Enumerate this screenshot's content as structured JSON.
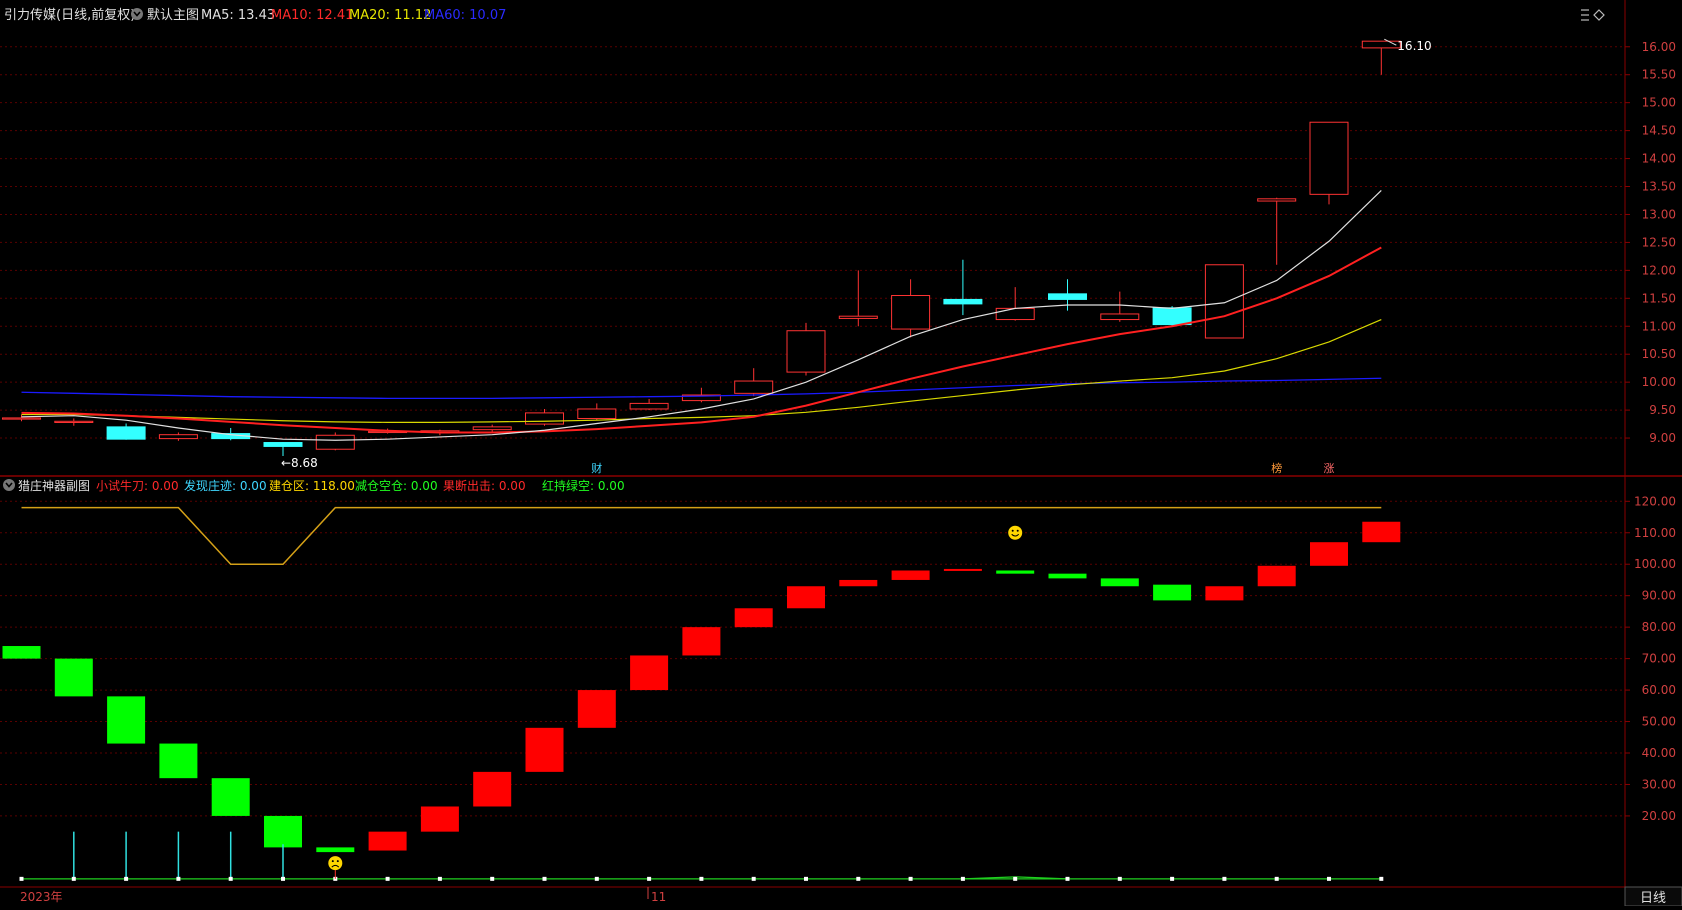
{
  "header": {
    "stock_title": "引力传媒(日线,前复权)",
    "main_chart_name": "默认主图",
    "ma_labels": [
      {
        "label": "MA5: 13.43",
        "color": "#e0e0e0"
      },
      {
        "label": "MA10: 12.41",
        "color": "#ff2a2a"
      },
      {
        "label": "MA20: 11.12",
        "color": "#e6e600"
      },
      {
        "label": "MA60: 10.07",
        "color": "#2a2aff"
      }
    ]
  },
  "sub_header": {
    "indicator_name": "猎庄神器副图",
    "labels": [
      {
        "label": "小试牛刀: 0.00",
        "color": "#ff2a2a"
      },
      {
        "label": "发现庄迹: 0.00",
        "color": "#3fd7ff"
      },
      {
        "label": "建仓区: 118.00",
        "color": "#ffd700"
      },
      {
        "label": "减仓空仓: 0.00",
        "color": "#20ff20"
      },
      {
        "label": "果断出击: 0.00",
        "color": "#ff2a2a"
      },
      {
        "label": "红持绿空: 0.00",
        "color": "#20ff20"
      }
    ]
  },
  "footer": {
    "year_label": "2023年",
    "month_label": "11",
    "period_label": "日线"
  },
  "colors": {
    "up": "#ff3333",
    "down": "#33ffff",
    "ma5": "#e0e0e0",
    "ma10": "#ff2020",
    "ma20": "#d8d800",
    "ma60": "#1a1aff",
    "grid": "#5a0000",
    "axis_text": "#d04040",
    "sub_up": "#ff0000",
    "sub_down": "#00ff00",
    "cang_line": "#d4a017",
    "spike": "#30e0e0"
  },
  "icons": {
    "close_icon_name": "circle-close-icon",
    "diamond_icon_name": "diamond-icon",
    "menu_icon_name": "menu-icon",
    "smile_icon_name": "smile-icon",
    "sad_icon_name": "sad-icon"
  },
  "chart_data": [
    {
      "type": "candlestick",
      "title": "引力传媒(日线,前复权)",
      "ylim": [
        8.5,
        16.3
      ],
      "y_ticks": [
        "9.00",
        "9.50",
        "10.00",
        "10.50",
        "11.00",
        "11.50",
        "12.00",
        "12.50",
        "13.00",
        "13.50",
        "14.00",
        "14.50",
        "15.00",
        "15.50",
        "16.00"
      ],
      "candles": [
        {
          "o": 9.36,
          "c": 9.36,
          "h": 9.42,
          "l": 9.3
        },
        {
          "o": 9.3,
          "c": 9.3,
          "h": 9.35,
          "l": 9.22
        },
        {
          "o": 9.2,
          "c": 8.98,
          "h": 9.26,
          "l": 8.97
        },
        {
          "o": 8.99,
          "c": 9.06,
          "h": 9.1,
          "l": 8.95
        },
        {
          "o": 9.08,
          "c": 8.99,
          "h": 9.18,
          "l": 8.96
        },
        {
          "o": 8.92,
          "c": 8.85,
          "h": 8.93,
          "l": 8.68
        },
        {
          "o": 8.8,
          "c": 9.05,
          "h": 9.1,
          "l": 8.78
        },
        {
          "o": 9.12,
          "c": 9.12,
          "h": 9.17,
          "l": 9.08
        },
        {
          "o": 9.1,
          "c": 9.13,
          "h": 9.15,
          "l": 9.05
        },
        {
          "o": 9.15,
          "c": 9.2,
          "h": 9.24,
          "l": 9.1
        },
        {
          "o": 9.25,
          "c": 9.45,
          "h": 9.52,
          "l": 9.22
        },
        {
          "o": 9.35,
          "c": 9.52,
          "h": 9.62,
          "l": 9.32
        },
        {
          "o": 9.52,
          "c": 9.62,
          "h": 9.7,
          "l": 9.5
        },
        {
          "o": 9.67,
          "c": 9.77,
          "h": 9.9,
          "l": 9.64
        },
        {
          "o": 9.8,
          "c": 10.02,
          "h": 10.25,
          "l": 9.75
        },
        {
          "o": 10.18,
          "c": 10.92,
          "h": 11.06,
          "l": 10.12
        },
        {
          "o": 11.14,
          "c": 11.18,
          "h": 12.0,
          "l": 11.0
        },
        {
          "o": 10.95,
          "c": 11.55,
          "h": 11.84,
          "l": 10.8
        },
        {
          "o": 11.48,
          "c": 11.4,
          "h": 12.19,
          "l": 11.2
        },
        {
          "o": 11.12,
          "c": 11.32,
          "h": 11.7,
          "l": 11.1
        },
        {
          "o": 11.58,
          "c": 11.48,
          "h": 11.84,
          "l": 11.28
        },
        {
          "o": 11.12,
          "c": 11.22,
          "h": 11.62,
          "l": 11.08
        },
        {
          "o": 11.33,
          "c": 11.03,
          "h": 11.36,
          "l": 11.01
        },
        {
          "o": 10.79,
          "c": 12.1,
          "h": 12.1,
          "l": 10.79
        },
        {
          "o": 13.24,
          "c": 13.28,
          "h": 13.3,
          "l": 12.1
        },
        {
          "o": 13.36,
          "c": 14.65,
          "h": 14.65,
          "l": 13.18
        },
        {
          "o": 15.98,
          "c": 16.1,
          "h": 16.1,
          "l": 15.5
        }
      ],
      "ma5": [
        9.38,
        9.4,
        9.32,
        9.18,
        9.06,
        8.98,
        8.96,
        8.98,
        9.02,
        9.06,
        9.14,
        9.26,
        9.38,
        9.52,
        9.7,
        10.0,
        10.4,
        10.82,
        11.12,
        11.32,
        11.38,
        11.38,
        11.32,
        11.42,
        11.82,
        12.52,
        13.43
      ],
      "ma10": [
        9.45,
        9.44,
        9.4,
        9.35,
        9.29,
        9.23,
        9.18,
        9.13,
        9.1,
        9.1,
        9.12,
        9.16,
        9.22,
        9.28,
        9.38,
        9.58,
        9.82,
        10.06,
        10.28,
        10.48,
        10.68,
        10.86,
        11.0,
        11.18,
        11.5,
        11.9,
        12.41
      ],
      "ma20": [
        9.42,
        9.42,
        9.4,
        9.37,
        9.34,
        9.31,
        9.29,
        9.28,
        9.28,
        9.29,
        9.3,
        9.32,
        9.35,
        9.37,
        9.4,
        9.46,
        9.55,
        9.66,
        9.76,
        9.86,
        9.95,
        10.02,
        10.08,
        10.2,
        10.42,
        10.72,
        11.12
      ],
      "ma60": [
        9.82,
        9.8,
        9.78,
        9.76,
        9.74,
        9.73,
        9.72,
        9.71,
        9.71,
        9.71,
        9.72,
        9.73,
        9.74,
        9.75,
        9.77,
        9.79,
        9.82,
        9.86,
        9.9,
        9.94,
        9.97,
        9.99,
        10.0,
        10.02,
        10.03,
        10.05,
        10.07
      ],
      "annotations": [
        {
          "text": "←8.68",
          "index": 5,
          "value": 8.68
        },
        {
          "text": "16.10",
          "index": 26,
          "value": 16.1
        }
      ],
      "event_markers": [
        {
          "text": "财",
          "index": 11,
          "color": "#3fd7ff"
        },
        {
          "text": "榜",
          "index": 24,
          "color": "#ff9a3a"
        },
        {
          "text": "涨",
          "index": 25,
          "color": "#ff6a6a"
        }
      ]
    },
    {
      "type": "bar",
      "title": "猎庄神器副图",
      "ylim": [
        -1,
        122
      ],
      "y_ticks": [
        "20.00",
        "30.00",
        "40.00",
        "50.00",
        "60.00",
        "70.00",
        "80.00",
        "90.00",
        "100.00",
        "110.00",
        "120.00"
      ],
      "blocks": [
        {
          "from": 74,
          "to": 70
        },
        {
          "from": 70,
          "to": 58
        },
        {
          "from": 58,
          "to": 43
        },
        {
          "from": 43,
          "to": 32
        },
        {
          "from": 32,
          "to": 20
        },
        {
          "from": 20,
          "to": 10
        },
        {
          "from": 10,
          "to": 8.5
        },
        {
          "from": 9,
          "to": 15
        },
        {
          "from": 15,
          "to": 23
        },
        {
          "from": 23,
          "to": 34
        },
        {
          "from": 34,
          "to": 48
        },
        {
          "from": 48,
          "to": 60
        },
        {
          "from": 60,
          "to": 71
        },
        {
          "from": 71,
          "to": 80
        },
        {
          "from": 80,
          "to": 86
        },
        {
          "from": 86,
          "to": 93
        },
        {
          "from": 93,
          "to": 95
        },
        {
          "from": 95,
          "to": 98
        },
        {
          "from": 98,
          "to": 98.5
        },
        {
          "from": 98,
          "to": 97
        },
        {
          "from": 97,
          "to": 95.5
        },
        {
          "from": 95.5,
          "to": 93
        },
        {
          "from": 93.5,
          "to": 88.5
        },
        {
          "from": 88.5,
          "to": 93
        },
        {
          "from": 93,
          "to": 99.5
        },
        {
          "from": 99.5,
          "to": 107
        },
        {
          "from": 107,
          "to": 113.5
        }
      ],
      "jiancang_line": [
        118,
        118,
        118,
        118,
        100,
        100,
        118,
        118,
        118,
        118,
        118,
        118,
        118,
        118,
        118,
        118,
        118,
        118,
        118,
        118,
        118,
        118,
        118,
        118,
        118,
        118,
        118
      ],
      "spikes": [
        0,
        15,
        15,
        15,
        15,
        11,
        0,
        0,
        0,
        0,
        0,
        0,
        0,
        0,
        0,
        0,
        0,
        0,
        0,
        0,
        0,
        0,
        0,
        0,
        0,
        0,
        0
      ],
      "smile_marker": {
        "index": 19,
        "value": 110
      },
      "sad_marker": {
        "index": 6,
        "value": 5
      }
    }
  ]
}
